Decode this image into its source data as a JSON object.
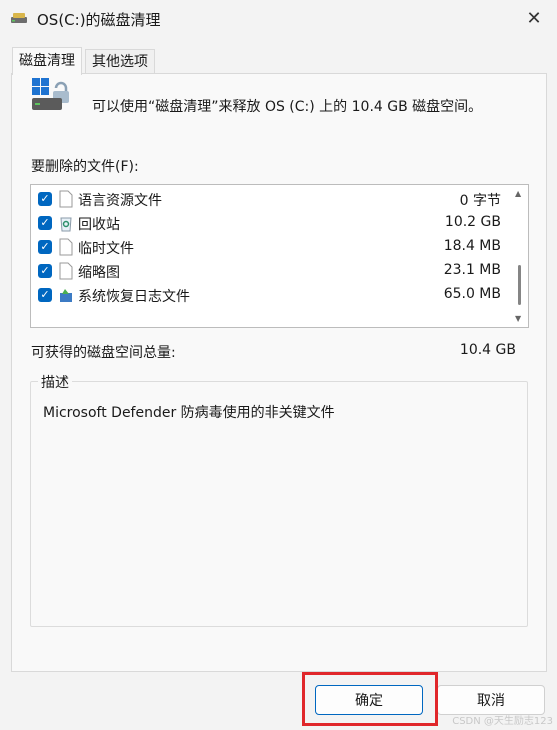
{
  "window": {
    "title": "OS(C:)的磁盘清理",
    "close_glyph": "✕"
  },
  "tabs": [
    {
      "label": "磁盘清理",
      "active": true
    },
    {
      "label": "其他选项",
      "active": false
    }
  ],
  "intro": "可以使用“磁盘清理”来释放 OS (C:) 上的 10.4 GB 磁盘空间。",
  "files_label": "要删除的文件(F):",
  "files": [
    {
      "name": "语言资源文件",
      "size": "0 字节",
      "checked": true,
      "icon": "document-icon"
    },
    {
      "name": "回收站",
      "size": "10.2 GB",
      "checked": true,
      "icon": "recycle-bin-icon"
    },
    {
      "name": "临时文件",
      "size": "18.4 MB",
      "checked": true,
      "icon": "document-icon"
    },
    {
      "name": "缩略图",
      "size": "23.1 MB",
      "checked": true,
      "icon": "document-icon"
    },
    {
      "name": "系统恢复日志文件",
      "size": "65.0 MB",
      "checked": true,
      "icon": "system-restore-icon"
    }
  ],
  "total_label": "可获得的磁盘空间总量:",
  "total_value": "10.4 GB",
  "description": {
    "title": "描述",
    "text": "Microsoft Defender 防病毒使用的非关键文件"
  },
  "buttons": {
    "ok": "确定",
    "cancel": "取消"
  },
  "watermark": "CSDN @天生励志123",
  "colors": {
    "accent": "#0067c0",
    "highlight": "#e0262a"
  }
}
